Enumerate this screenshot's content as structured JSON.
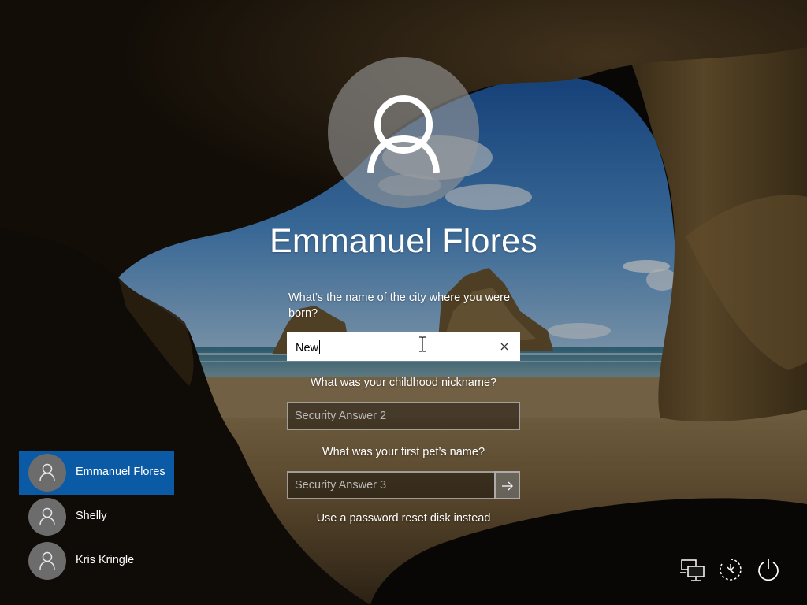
{
  "login": {
    "user_name": "Emmanuel Flores",
    "question_1": "What’s the name of the city where you were born?",
    "answer_1_value": "New",
    "question_2": "What was your childhood nickname?",
    "answer_2_placeholder": "Security Answer 2",
    "question_3": "What was your first pet’s name?",
    "answer_3_placeholder": "Security Answer 3",
    "reset_disk_link": "Use a password reset disk instead",
    "clear_icon": "close-icon",
    "submit_icon": "arrow-right-icon"
  },
  "user_list": [
    {
      "name": "Emmanuel Flores",
      "selected": true
    },
    {
      "name": "Shelly",
      "selected": false
    },
    {
      "name": "Kris Kringle",
      "selected": false
    }
  ],
  "system_icons": [
    "network-icon",
    "ease-of-access-icon",
    "power-icon"
  ],
  "colors": {
    "selected_user_bg": "#0a5aa5",
    "text": "#ffffff",
    "avatar_bg": "#6c6c6c"
  }
}
